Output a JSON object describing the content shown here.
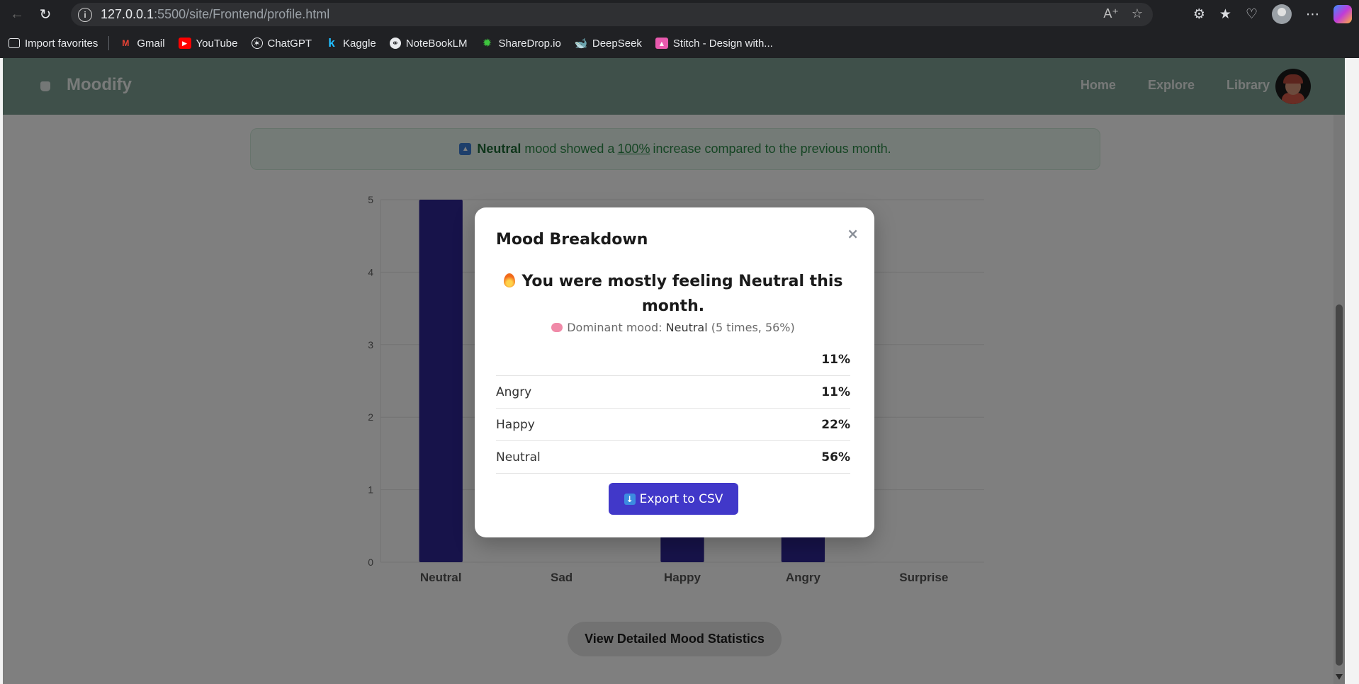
{
  "browser": {
    "url_host": "127.0.0.1",
    "url_path": ":5500/site/Frontend/profile.html",
    "bookmarks": [
      {
        "label": "Import favorites",
        "icon": "import-icon"
      },
      {
        "label": "Gmail",
        "icon": "gmail-icon",
        "color": "#ea4335"
      },
      {
        "label": "YouTube",
        "icon": "youtube-icon",
        "color": "#ff0000"
      },
      {
        "label": "ChatGPT",
        "icon": "chatgpt-icon"
      },
      {
        "label": "Kaggle",
        "icon": "kaggle-icon",
        "color": "#20beff"
      },
      {
        "label": "NoteBookLM",
        "icon": "notebooklm-icon"
      },
      {
        "label": "ShareDrop.io",
        "icon": "sharedrop-icon",
        "color": "#3ec43e"
      },
      {
        "label": "DeepSeek",
        "icon": "deepseek-icon",
        "color": "#4d6bfe"
      },
      {
        "label": "Stitch - Design with...",
        "icon": "stitch-icon",
        "color": "#e85aae"
      }
    ]
  },
  "site": {
    "brand": "Moodify",
    "nav": [
      "Home",
      "Explore",
      "Library"
    ]
  },
  "alert": {
    "mood": "Neutral",
    "text_before": "mood showed a",
    "percent": "100%",
    "text_after": "increase compared to the previous month."
  },
  "chart_data": {
    "type": "bar",
    "categories": [
      "Neutral",
      "Sad",
      "Happy",
      "Angry",
      "Surprise"
    ],
    "values": [
      5,
      0,
      1,
      1,
      0
    ],
    "ylim": [
      0,
      5
    ],
    "yticks": [
      0,
      1,
      2,
      3,
      4,
      5
    ],
    "bar_color": "#2e2794",
    "grid": true
  },
  "detail_button": "View Detailed Mood Statistics",
  "modal": {
    "title": "Mood Breakdown",
    "close": "×",
    "headline": "You were mostly feeling Neutral this month.",
    "sub_label": "Dominant mood:",
    "sub_mood": "Neutral",
    "sub_stats": "(5 times, 56%)",
    "rows": [
      {
        "label": "",
        "percent": "11%"
      },
      {
        "label": "Angry",
        "percent": "11%"
      },
      {
        "label": "Happy",
        "percent": "22%"
      },
      {
        "label": "Neutral",
        "percent": "56%"
      }
    ],
    "export_label": "Export to CSV"
  },
  "colors": {
    "header": "#7fa094",
    "accent": "#4138c9",
    "alert_bg": "#e9f7ee",
    "alert_text": "#2c8a49"
  }
}
